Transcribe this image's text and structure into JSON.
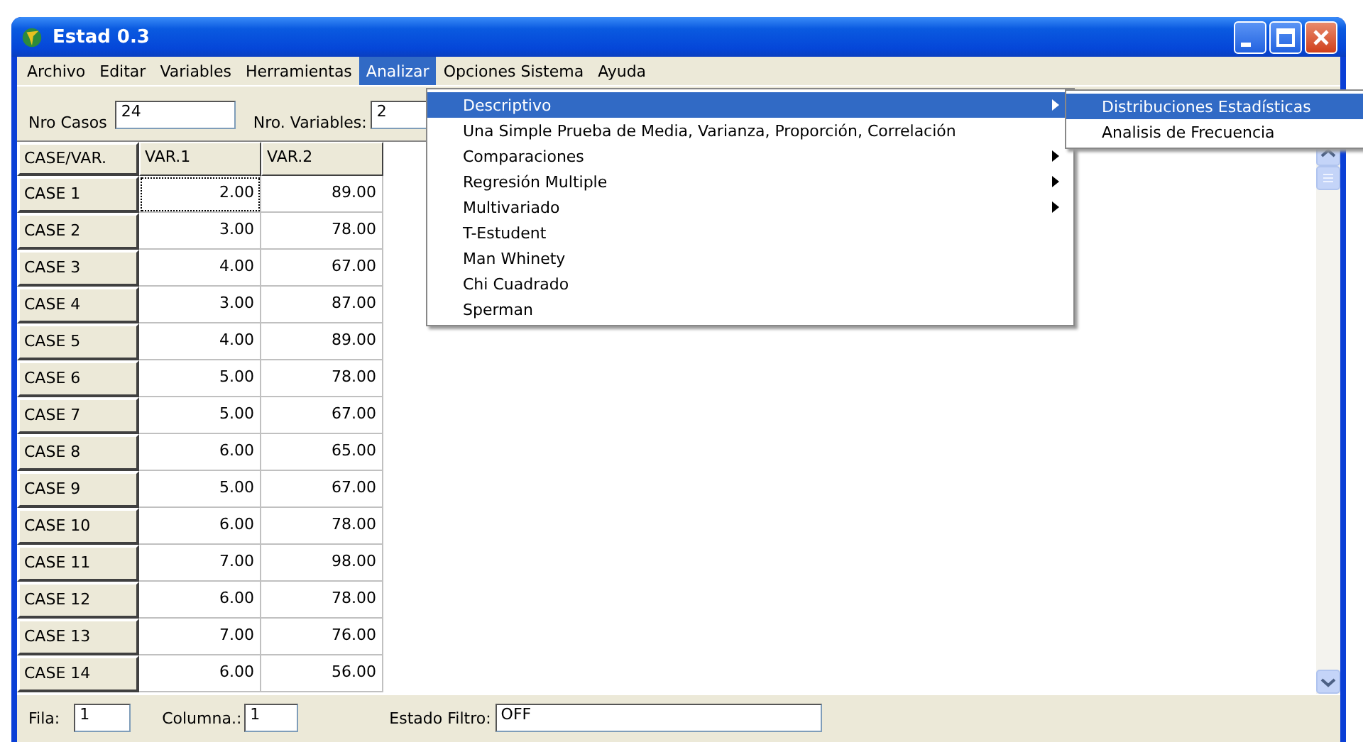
{
  "window": {
    "title": "Estad 0.3"
  },
  "menubar": [
    {
      "label": "Archivo",
      "selected": false
    },
    {
      "label": "Editar",
      "selected": false
    },
    {
      "label": "Variables",
      "selected": false
    },
    {
      "label": "Herramientas",
      "selected": false
    },
    {
      "label": "Analizar",
      "selected": true
    },
    {
      "label": "Opciones Sistema",
      "selected": false
    },
    {
      "label": "Ayuda",
      "selected": false
    }
  ],
  "toolbar": {
    "cases_label": "Nro Casos",
    "cases_value": "24",
    "variables_label": "Nro. Variables:",
    "variables_value": "2"
  },
  "menu": [
    {
      "label": "Descriptivo",
      "submenu": true,
      "selected": true
    },
    {
      "label": "Una Simple Prueba de Media, Varianza, Proporción, Correlación",
      "submenu": false,
      "selected": false
    },
    {
      "label": "Comparaciones",
      "submenu": true,
      "selected": false
    },
    {
      "label": "Regresión Multiple",
      "submenu": true,
      "selected": false
    },
    {
      "label": "Multivariado",
      "submenu": true,
      "selected": false
    },
    {
      "label": "T-Estudent",
      "submenu": false,
      "selected": false
    },
    {
      "label": "Man Whinety",
      "submenu": false,
      "selected": false
    },
    {
      "label": "Chi Cuadrado",
      "submenu": false,
      "selected": false
    },
    {
      "label": "Sperman",
      "submenu": false,
      "selected": false
    }
  ],
  "submenu": [
    {
      "label": "Distribuciones Estadísticas",
      "selected": true
    },
    {
      "label": "Analisis de Frecuencia",
      "selected": false
    }
  ],
  "table": {
    "columns": [
      "CASE/VAR.",
      "VAR.1",
      "VAR.2"
    ],
    "rows": [
      {
        "label": "CASE 1",
        "cells": [
          {
            "text": "2.00",
            "focused": true
          },
          {
            "text": "89.00",
            "focused": false
          }
        ]
      },
      {
        "label": "CASE 2",
        "cells": [
          {
            "text": "3.00",
            "focused": false
          },
          {
            "text": "78.00",
            "focused": false
          }
        ]
      },
      {
        "label": "CASE 3",
        "cells": [
          {
            "text": "4.00",
            "focused": false
          },
          {
            "text": "67.00",
            "focused": false
          }
        ]
      },
      {
        "label": "CASE 4",
        "cells": [
          {
            "text": "3.00",
            "focused": false
          },
          {
            "text": "87.00",
            "focused": false
          }
        ]
      },
      {
        "label": "CASE 5",
        "cells": [
          {
            "text": "4.00",
            "focused": false
          },
          {
            "text": "89.00",
            "focused": false
          }
        ]
      },
      {
        "label": "CASE 6",
        "cells": [
          {
            "text": "5.00",
            "focused": false
          },
          {
            "text": "78.00",
            "focused": false
          }
        ]
      },
      {
        "label": "CASE 7",
        "cells": [
          {
            "text": "5.00",
            "focused": false
          },
          {
            "text": "67.00",
            "focused": false
          }
        ]
      },
      {
        "label": "CASE 8",
        "cells": [
          {
            "text": "6.00",
            "focused": false
          },
          {
            "text": "65.00",
            "focused": false
          }
        ]
      },
      {
        "label": "CASE 9",
        "cells": [
          {
            "text": "5.00",
            "focused": false
          },
          {
            "text": "67.00",
            "focused": false
          }
        ]
      },
      {
        "label": "CASE 10",
        "cells": [
          {
            "text": "6.00",
            "focused": false
          },
          {
            "text": "78.00",
            "focused": false
          }
        ]
      },
      {
        "label": "CASE 11",
        "cells": [
          {
            "text": "7.00",
            "focused": false
          },
          {
            "text": "98.00",
            "focused": false
          }
        ]
      },
      {
        "label": "CASE 12",
        "cells": [
          {
            "text": "6.00",
            "focused": false
          },
          {
            "text": "78.00",
            "focused": false
          }
        ]
      },
      {
        "label": "CASE 13",
        "cells": [
          {
            "text": "7.00",
            "focused": false
          },
          {
            "text": "76.00",
            "focused": false
          }
        ]
      },
      {
        "label": "CASE 14",
        "cells": [
          {
            "text": "6.00",
            "focused": false
          },
          {
            "text": "56.00",
            "focused": false
          }
        ]
      }
    ]
  },
  "status_bar": {
    "row_label": "Fila:",
    "row_value": "1",
    "column_label": "Columna.:",
    "column_value": "1",
    "filter_label": "Estado Filtro:",
    "filter_value": "OFF"
  }
}
